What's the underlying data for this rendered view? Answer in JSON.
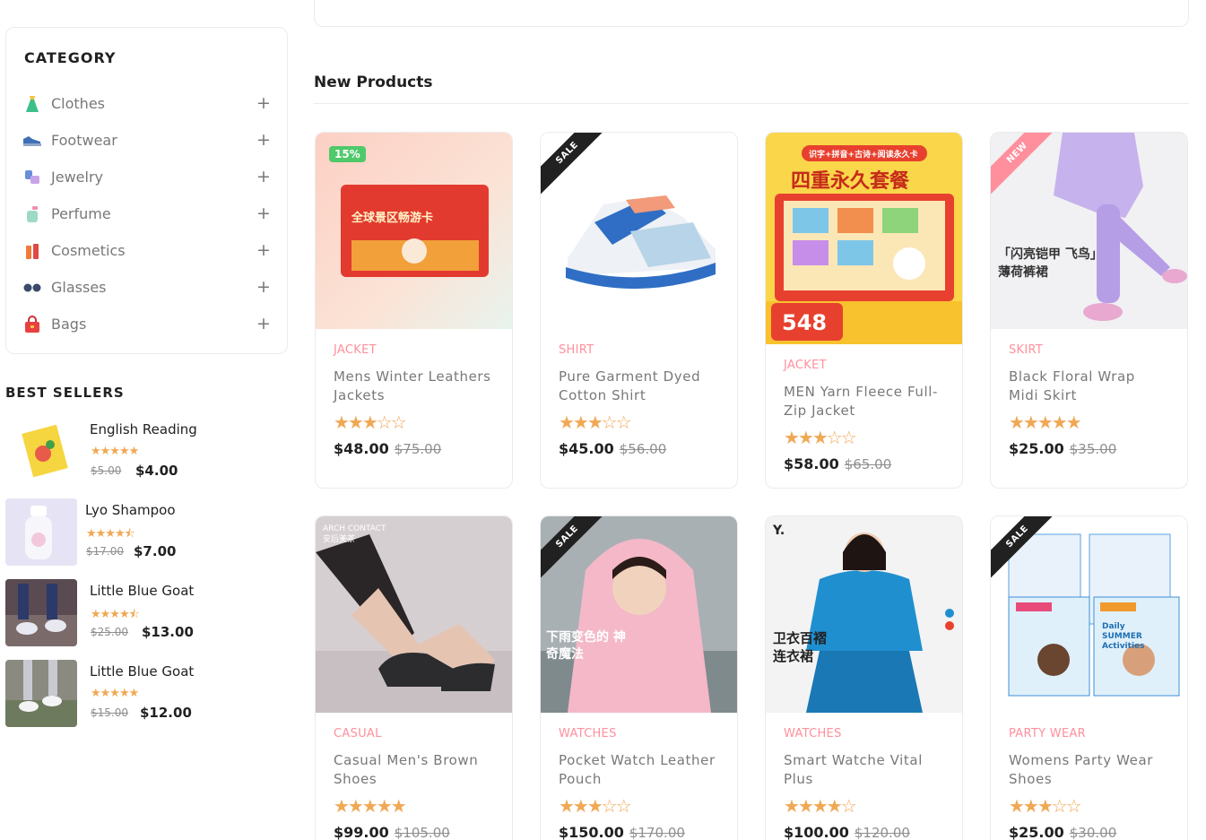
{
  "sidebar": {
    "category_title": "CATEGORY",
    "categories": [
      {
        "label": "Clothes",
        "icon": "dress-icon"
      },
      {
        "label": "Footwear",
        "icon": "shoe-icon"
      },
      {
        "label": "Jewelry",
        "icon": "watch-icon"
      },
      {
        "label": "Perfume",
        "icon": "perfume-icon"
      },
      {
        "label": "Cosmetics",
        "icon": "cosmetics-icon"
      },
      {
        "label": "Glasses",
        "icon": "glasses-icon"
      },
      {
        "label": "Bags",
        "icon": "bag-icon"
      }
    ],
    "expand_symbol": "+",
    "best_sellers_title": "BEST SELLERS",
    "best_sellers": [
      {
        "name": "English Reading",
        "stars": "★★★★★",
        "old_price": "$5.00",
        "price": "$4.00"
      },
      {
        "name": "Lyo Shampoo",
        "stars": "★★★★⯪",
        "old_price": "$17.00",
        "price": "$7.00"
      },
      {
        "name": "Little Blue Goat",
        "stars": "★★★★⯪",
        "old_price": "$25.00",
        "price": "$13.00"
      },
      {
        "name": "Little Blue Goat",
        "stars": "★★★★★",
        "old_price": "$15.00",
        "price": "$12.00"
      }
    ]
  },
  "main": {
    "section_title": "New Products",
    "products": [
      {
        "category": "JACKET",
        "title": "Mens Winter Leathers Jackets",
        "stars": "★★★☆☆",
        "price": "$48.00",
        "old_price": "$75.00",
        "badge": "15%",
        "image_text": "全球景区畅游卡"
      },
      {
        "category": "SHIRT",
        "title": "Pure Garment Dyed Cotton Shirt",
        "stars": "★★★☆☆",
        "price": "$45.00",
        "old_price": "$56.00",
        "badge": "SALE"
      },
      {
        "category": "JACKET",
        "title": "MEN Yarn Fleece Full-Zip Jacket",
        "stars": "★★★☆☆",
        "price": "$58.00",
        "old_price": "$65.00",
        "image_text": "四重永久套餐",
        "image_price": "548",
        "image_sub": "识字+拼音+古诗+阅读永久卡"
      },
      {
        "category": "SKIRT",
        "title": "Black Floral Wrap Midi Skirt",
        "stars": "★★★★★",
        "price": "$25.00",
        "old_price": "$35.00",
        "badge": "NEW",
        "image_text": "「闪亮铠甲 飞鸟」薄荷裤裙"
      },
      {
        "category": "CASUAL",
        "title": "Casual Men's Brown Shoes",
        "stars": "★★★★★",
        "price": "$99.00",
        "old_price": "$105.00",
        "image_text": "ARCH CONTACT 安后美茶"
      },
      {
        "category": "WATCHES",
        "title": "Pocket Watch Leather Pouch",
        "stars": "★★★☆☆",
        "price": "$150.00",
        "old_price": "$170.00",
        "badge": "SALE",
        "image_text": "下雨变色的 神奇魔法"
      },
      {
        "category": "WATCHES",
        "title": "Smart Watche Vital Plus",
        "stars": "★★★★☆",
        "price": "$100.00",
        "old_price": "$120.00",
        "image_text": "卫衣百褶 连衣裙"
      },
      {
        "category": "PARTY WEAR",
        "title": "Womens Party Wear Shoes",
        "stars": "★★★☆☆",
        "price": "$25.00",
        "old_price": "$30.00",
        "badge": "SALE",
        "image_text": "Daily SUMMER Activities"
      }
    ]
  },
  "colors": {
    "accent_pink": "#ff8f9c",
    "star_orange": "#f0a854",
    "badge_green": "#4fc96a",
    "ribbon_dark": "#212121"
  }
}
